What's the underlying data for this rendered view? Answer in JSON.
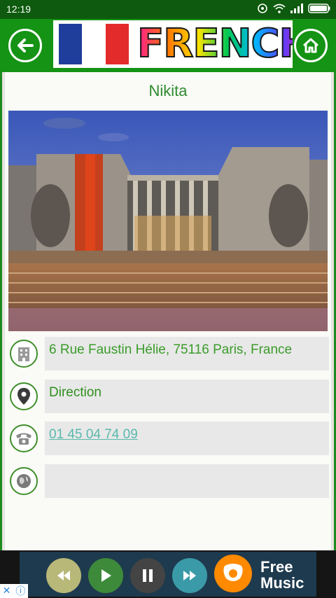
{
  "status_bar": {
    "time": "12:19"
  },
  "header": {
    "banner_text": "FRENCH"
  },
  "place": {
    "title": "Nikita",
    "address": "6 Rue Faustin Hélie, 75116 Paris, France",
    "direction_label": "Direction",
    "phone": "01 45 04 74 09",
    "website": ""
  },
  "ad": {
    "line1": "Free",
    "line2": "Music"
  },
  "icons": {
    "back": "arrow-left-icon",
    "home": "home-icon",
    "address": "building-icon",
    "direction": "map-pin-icon",
    "phone": "telephone-icon",
    "website": "globe-icon"
  },
  "colors": {
    "header": "#149314",
    "text_green": "#2e8b2e",
    "link": "#59b9ad"
  }
}
